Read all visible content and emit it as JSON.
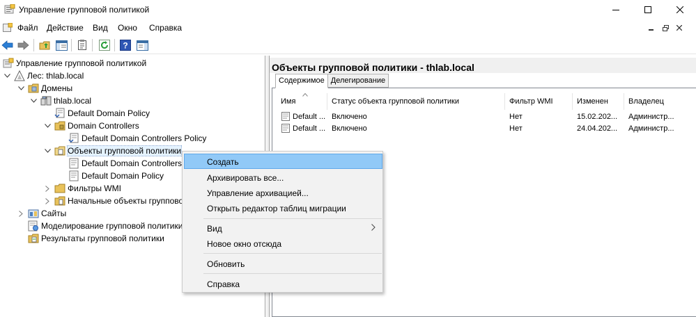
{
  "window": {
    "title": "Управление групповой политикой",
    "icon": "gpmc-app-icon"
  },
  "menubar": {
    "items": [
      "Файл",
      "Действие",
      "Вид",
      "Окно",
      "Справка"
    ]
  },
  "toolbar": {
    "icons": [
      "back-arrow-icon",
      "forward-arrow-icon",
      "up-folder-icon",
      "show-hide-tree-icon",
      "properties-icon",
      "refresh-icon",
      "help-icon",
      "action-pane-icon"
    ]
  },
  "tree": {
    "root": "Управление групповой политикой",
    "forest": "Лес: thlab.local",
    "domains": "Домены",
    "domain": "thlab.local",
    "default_domain_policy": "Default Domain Policy",
    "domain_controllers": "Domain Controllers",
    "default_dc_policy": "Default Domain Controllers Policy",
    "gpo_container": "Объекты групповой политики",
    "gpo_dc_policy": "Default Domain Controllers",
    "gpo_domain_policy": "Default Domain Policy",
    "wmi_filters": "Фильтры WMI",
    "starter_gpos": "Начальные объекты групповой",
    "sites": "Сайты",
    "modeling": "Моделирование групповой политики",
    "results": "Результаты групповой политики"
  },
  "rightpane": {
    "title": "Объекты групповой политики - thlab.local",
    "tabs": [
      "Содержимое",
      "Делегирование"
    ],
    "columns": [
      "Имя",
      "Статус объекта групповой политики",
      "Фильтр WMI",
      "Изменен",
      "Владелец"
    ],
    "rows": [
      {
        "name": "Default ...",
        "status": "Включено",
        "wmi": "Нет",
        "modified": "15.02.202...",
        "owner": "Администр..."
      },
      {
        "name": "Default ...",
        "status": "Включено",
        "wmi": "Нет",
        "modified": "24.04.202...",
        "owner": "Администр..."
      }
    ]
  },
  "context_menu": {
    "create": "Создать",
    "backup_all": "Архивировать все...",
    "manage_backups": "Управление архивацией...",
    "migration_editor": "Открыть редактор таблиц миграции",
    "view": "Вид",
    "new_window": "Новое окно отсюда",
    "refresh": "Обновить",
    "help": "Справка"
  },
  "colors": {
    "menu_highlight": "#91c9f7",
    "menu_bg": "#f2f2f2",
    "selection": "#e5f3ff"
  }
}
